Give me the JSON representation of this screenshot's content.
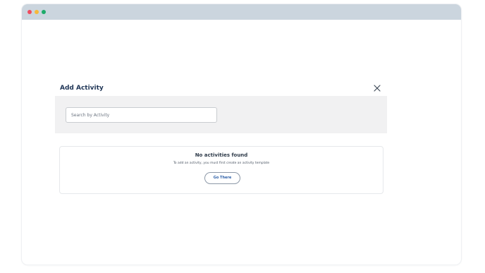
{
  "window": {
    "controls": [
      "close",
      "minimize",
      "maximize"
    ]
  },
  "dialog": {
    "title": "Add Activity",
    "close_icon": "close-icon",
    "search": {
      "placeholder": "Search by Activity",
      "value": ""
    },
    "empty_state": {
      "title": "No activities found",
      "message": "To add an activity, you must first create an activity template",
      "button_label": "Go There"
    }
  },
  "colors": {
    "titlebar": "#cbd5de",
    "dot_red": "#ef4b5f",
    "dot_yellow": "#f6b93b",
    "dot_green": "#1dab6a",
    "title_text": "#1f3556",
    "search_panel": "#f1f1f2",
    "link_blue": "#2b5ea7"
  }
}
